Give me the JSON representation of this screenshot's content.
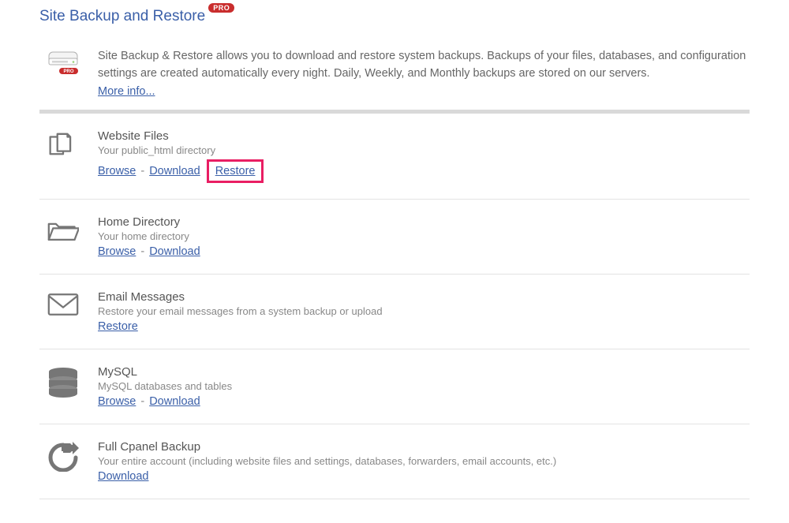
{
  "page_title": "Site Backup and Restore",
  "pro_badge": "PRO",
  "intro_text": "Site Backup & Restore allows you to download and restore system backups. Backups of your files, databases, and configuration settings are created automatically every night. Daily, Weekly, and Monthly backups are stored on our servers.",
  "more_info": "More info...",
  "sections": {
    "website_files": {
      "title": "Website Files",
      "desc": "Your public_html directory",
      "browse": "Browse",
      "download": "Download",
      "restore": "Restore"
    },
    "home_directory": {
      "title": "Home Directory",
      "desc": "Your home directory",
      "browse": "Browse",
      "download": "Download"
    },
    "email_messages": {
      "title": "Email Messages",
      "desc": "Restore your email messages from a system backup or upload",
      "restore": "Restore"
    },
    "mysql": {
      "title": "MySQL",
      "desc": "MySQL databases and tables",
      "browse": "Browse",
      "download": "Download"
    },
    "full_cpanel": {
      "title": "Full Cpanel Backup",
      "desc": "Your entire account (including website files and settings, databases, forwarders, email accounts, etc.)",
      "download": "Download"
    }
  },
  "separator": "-"
}
